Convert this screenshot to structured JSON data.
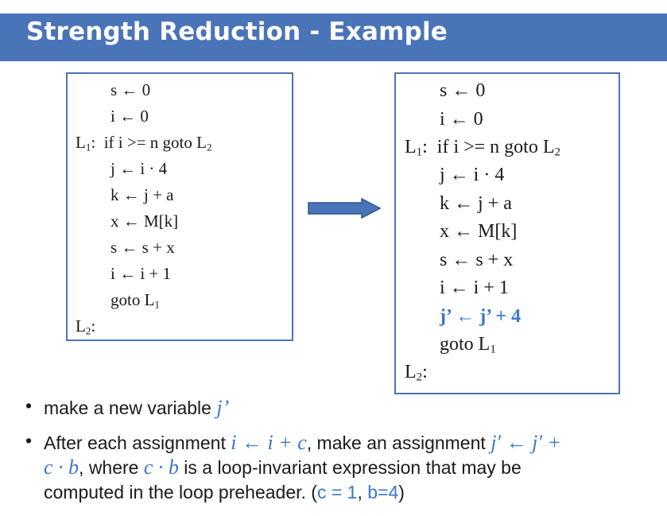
{
  "slide": {
    "title": "Strength Reduction - Example"
  },
  "left_code": {
    "lines": [
      "s ← 0",
      "i ← 0",
      "if i >= n goto L",
      "j ← i · 4",
      "k ← j + a",
      "x ← M[k]",
      "s ← s + x",
      "i ← i + 1",
      "goto L",
      ""
    ],
    "label_l1": "L",
    "label_l1_sub": "1",
    "label_l1_colon": ":",
    "goto_l2_sub": "2",
    "goto_l1_sub": "1",
    "label_l2": "L",
    "label_l2_sub": "2",
    "label_l2_colon": ":"
  },
  "right_code": {
    "lines": [
      "s ← 0",
      "i ← 0",
      "if i >= n goto L",
      "j ← i · 4",
      "k ← j + a",
      "x ← M[k]",
      "s ← s + x",
      "i ← i + 1",
      "j’ ← j’ + 4",
      "goto L"
    ],
    "label_l1": "L",
    "label_l1_sub": "1",
    "label_l1_colon": ":",
    "goto_l2_sub": "2",
    "goto_l1_sub": "1",
    "label_l2": "L",
    "label_l2_sub": "2",
    "label_l2_colon": ":"
  },
  "bullets": {
    "b1_text": "make a new variable ",
    "b1_var": "j’",
    "b2_pre": "After each assignment ",
    "b2_expr1": "i ← i + c",
    "b2_mid": ", make an assignment ",
    "b2_expr2a": "j′ ← j′ +",
    "b2_expr2b": "c · b",
    "b2_mid2": ", where ",
    "b2_expr3": "c · b",
    "b2_post": " is a loop-invariant expression that may be",
    "b2_line3": "computed in the loop preheader. (",
    "b2_c": "c = 1",
    "b2_comma": ", ",
    "b2_b": "b=4",
    "b2_close": ")"
  },
  "colors": {
    "accent": "#4a74b8",
    "highlight": "#3b78c8"
  }
}
